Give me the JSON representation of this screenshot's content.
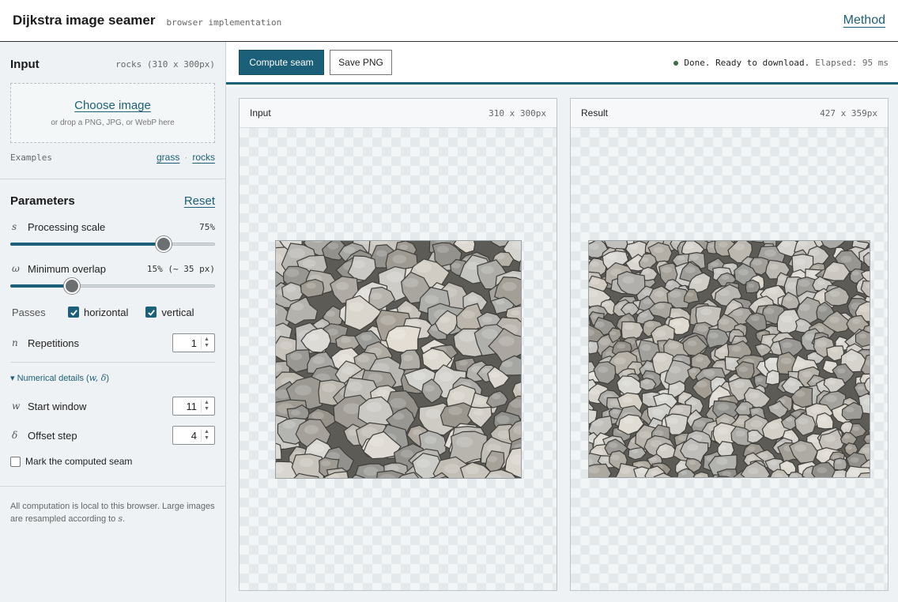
{
  "header": {
    "title": "Dijkstra image seamer",
    "subtitle": "browser implementation",
    "method_link": "Method"
  },
  "sidebar": {
    "input": {
      "title": "Input",
      "current": "rocks (310 x 300px)",
      "choose_label": "Choose image",
      "drop_hint": "or drop a PNG, JPG, or WebP here",
      "examples_label": "Examples",
      "examples": [
        "grass",
        "rocks"
      ],
      "examples_separator": "·"
    },
    "params": {
      "title": "Parameters",
      "reset_label": "Reset",
      "scale": {
        "symbol": "s",
        "label": "Processing scale",
        "value_text": "75%",
        "value": 0.75
      },
      "overlap": {
        "symbol": "ω",
        "label": "Minimum overlap",
        "value_text": "15% (~ 35 px)",
        "value": 0.15
      },
      "passes": {
        "label": "Passes",
        "horizontal": {
          "label": "horizontal",
          "checked": true
        },
        "vertical": {
          "label": "vertical",
          "checked": true
        }
      },
      "repetitions": {
        "symbol": "n",
        "label": "Repetitions",
        "value": "1"
      },
      "details_toggle": "▾ Numerical details (w, δ)",
      "details_toggle_prefix": "▾ Numerical details (",
      "details_toggle_vars": "w, δ",
      "details_toggle_suffix": ")",
      "start_window": {
        "symbol": "w",
        "label": "Start window",
        "value": "11"
      },
      "offset_step": {
        "symbol": "δ",
        "label": "Offset step",
        "value": "4"
      },
      "mark_seam": {
        "label": "Mark the computed seam",
        "checked": false
      }
    },
    "footer_text": "All computation is local to this browser. Large images are resampled according to s.",
    "footer_prefix": "All computation is local to this browser. Large images are resampled according to ",
    "footer_var": "s",
    "footer_suffix": "."
  },
  "toolbar": {
    "compute_label": "Compute seam",
    "save_label": "Save PNG",
    "status_text": "Done. Ready to download.",
    "elapsed_text": "Elapsed: 95 ms",
    "status_color": "#3d6b4a"
  },
  "panels": {
    "input": {
      "title": "Input",
      "dims": "310 x 300px"
    },
    "result": {
      "title": "Result",
      "dims": "427 x 359px"
    }
  },
  "colors": {
    "accent": "#1c5f78",
    "sidebar_bg": "#eef2f4"
  },
  "icons": {
    "checkbox_checked": "check-icon",
    "spin": "spin-arrows-icon",
    "status": "status-dot-icon"
  }
}
